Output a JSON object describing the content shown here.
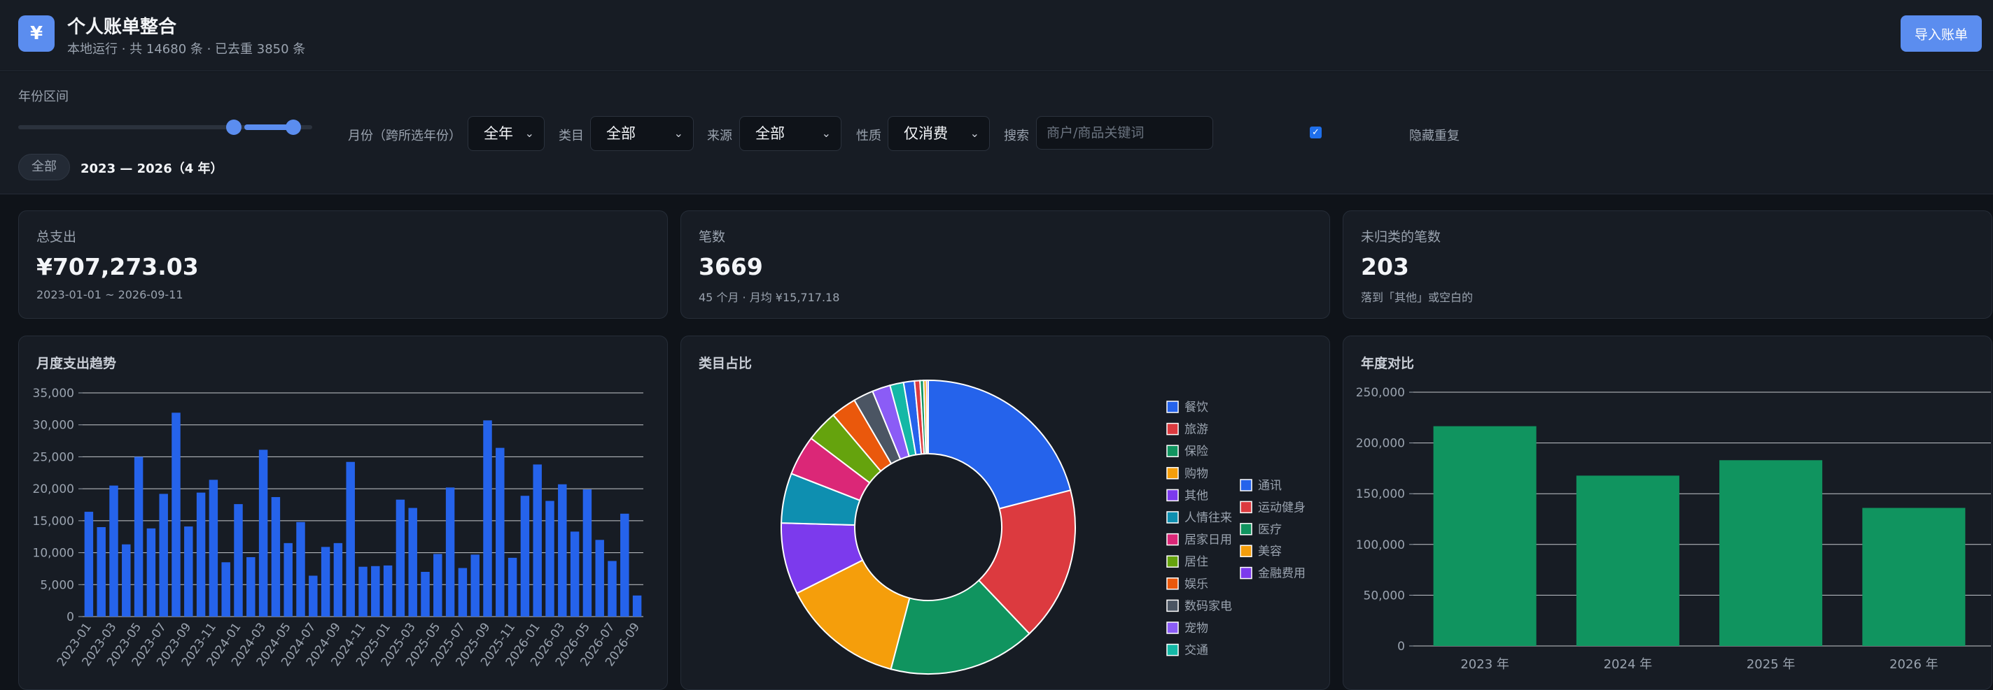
{
  "header": {
    "logo_glyph": "¥",
    "title": "个人账单整合",
    "subtitle": "本地运行 · 共 14680 条 · 已去重 3850 条",
    "import_label": "导入账单"
  },
  "filters": {
    "year_range_label": "年份区间",
    "month_label": "月份（跨所选年份）",
    "month_value": "全年",
    "category_label": "类目",
    "category_value": "全部",
    "source_label": "来源",
    "source_value": "全部",
    "nature_label": "性质",
    "nature_value": "仅消费",
    "search_label": "搜索",
    "search_placeholder": "商户/商品关键词",
    "hide_duplicates_label": "隐藏重复",
    "hide_duplicates_checked": true,
    "all_button": "全部",
    "range_text": "2023 — 2026（4 年）",
    "accent": "#5b8def"
  },
  "stats": [
    {
      "label": "总支出",
      "value": "¥707,273.03",
      "note": "2023-01-01 ~ 2026-09-11"
    },
    {
      "label": "笔数",
      "value": "3669",
      "note": "45 个月 · 月均 ¥15,717.18"
    },
    {
      "label": "未归类的笔数",
      "value": "203",
      "note": "落到「其他」或空白的"
    }
  ],
  "charts": {
    "monthly_title": "月度支出趋势",
    "category_title": "类目占比",
    "yearly_title": "年度对比"
  },
  "chart_data": [
    {
      "type": "bar",
      "title": "月度支出趋势",
      "ylim": [
        0,
        35000
      ],
      "yticks": [
        "0",
        "5,000",
        "10,000",
        "15,000",
        "20,000",
        "25,000",
        "30,000",
        "35,000"
      ],
      "ytick_values": [
        0,
        5000,
        10000,
        15000,
        20000,
        25000,
        30000,
        35000
      ],
      "categories": [
        "2023-01",
        "2023-02",
        "2023-03",
        "2023-04",
        "2023-05",
        "2023-06",
        "2023-07",
        "2023-08",
        "2023-09",
        "2023-10",
        "2023-11",
        "2023-12",
        "2024-01",
        "2024-02",
        "2024-03",
        "2024-04",
        "2024-05",
        "2024-06",
        "2024-07",
        "2024-08",
        "2024-09",
        "2024-10",
        "2024-11",
        "2024-12",
        "2025-01",
        "2025-02",
        "2025-03",
        "2025-04",
        "2025-05",
        "2025-06",
        "2025-07",
        "2025-08",
        "2025-09",
        "2025-10",
        "2025-11",
        "2025-12",
        "2026-01",
        "2026-02",
        "2026-03",
        "2026-04",
        "2026-05",
        "2026-06",
        "2026-07",
        "2026-08",
        "2026-09"
      ],
      "values": [
        16400,
        14000,
        20500,
        11300,
        25000,
        13800,
        19200,
        31900,
        14100,
        19400,
        21400,
        8500,
        17600,
        9300,
        26100,
        18700,
        11500,
        14800,
        6400,
        10900,
        11500,
        24200,
        7800,
        7900,
        8000,
        18300,
        17000,
        7000,
        9800,
        20200,
        7600,
        9700,
        30700,
        26400,
        9200,
        18900,
        23800,
        18100,
        20700,
        13300,
        19900,
        12000,
        8700,
        16100,
        3300
      ],
      "tick_labels": [
        "2023-01",
        "2023-03",
        "2023-05",
        "2023-07",
        "2023-09",
        "2023-11",
        "2024-01",
        "2024-03",
        "2024-05",
        "2024-07",
        "2024-09",
        "2024-11",
        "2025-01",
        "2025-03",
        "2025-05",
        "2025-07",
        "2025-09",
        "2025-11",
        "2026-01",
        "2026-03",
        "2026-05",
        "2026-07",
        "2026-09"
      ],
      "color": "#2563eb",
      "grid": true
    },
    {
      "type": "pie",
      "title": "类目占比",
      "donut": true,
      "slices": [
        {
          "name": "餐饮",
          "value": 21,
          "color": "#2563eb"
        },
        {
          "name": "旅游",
          "value": 17,
          "color": "#dc3a3f"
        },
        {
          "name": "保险",
          "value": 16.2,
          "color": "#10945f"
        },
        {
          "name": "购物",
          "value": 13.5,
          "color": "#f59e0b"
        },
        {
          "name": "其他",
          "value": 7.9,
          "color": "#7c3aed"
        },
        {
          "name": "人情往来",
          "value": 5.5,
          "color": "#0e8fb0"
        },
        {
          "name": "居家日用",
          "value": 4.4,
          "color": "#db2777"
        },
        {
          "name": "居住",
          "value": 3.5,
          "color": "#65a30d"
        },
        {
          "name": "娱乐",
          "value": 2.8,
          "color": "#ea580c"
        },
        {
          "name": "数码家电",
          "value": 2.2,
          "color": "#4b5563"
        },
        {
          "name": "宠物",
          "value": 2,
          "color": "#8b5cf6"
        },
        {
          "name": "交通",
          "value": 1.5,
          "color": "#14b8a6"
        },
        {
          "name": "通讯",
          "value": 1.2,
          "color": "#2563eb"
        },
        {
          "name": "运动健身",
          "value": 0.6,
          "color": "#dc3a3f"
        },
        {
          "name": "医疗",
          "value": 0.4,
          "color": "#10945f"
        },
        {
          "name": "美容",
          "value": 0.3,
          "color": "#f59e0b"
        },
        {
          "name": "金融费用",
          "value": 0.2,
          "color": "#7c3aed"
        }
      ],
      "legend_placement": "right"
    },
    {
      "type": "bar",
      "title": "年度对比",
      "ylim": [
        0,
        250000
      ],
      "yticks": [
        "0",
        "50,000",
        "100,000",
        "150,000",
        "200,000",
        "250,000"
      ],
      "ytick_values": [
        0,
        50000,
        100000,
        150000,
        200000,
        250000
      ],
      "categories": [
        "2023 年",
        "2024 年",
        "2025 年",
        "2026 年"
      ],
      "values": [
        216500,
        167800,
        183000,
        136000
      ],
      "color": "#10945f",
      "grid": true
    }
  ]
}
